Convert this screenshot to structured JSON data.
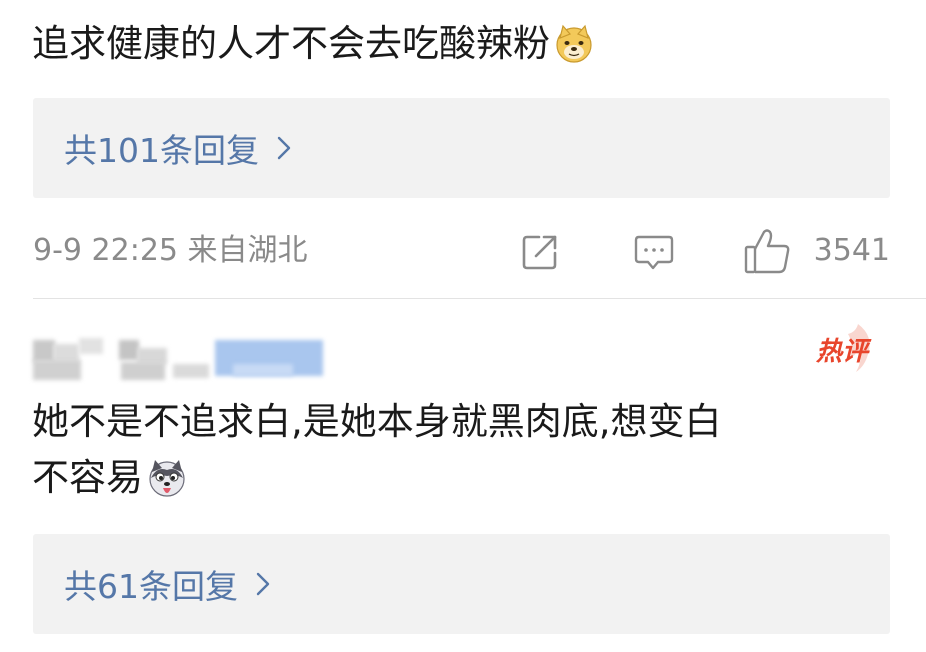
{
  "comment1": {
    "text": "追求健康的人才不会去吃酸辣粉",
    "emoji": "doge-emoji",
    "replies_label": "共101条回复"
  },
  "meta": {
    "time_location": "9-9 22:25 来自湖北",
    "like_count": "3541",
    "icons": [
      "share-icon",
      "comment-icon",
      "like-icon"
    ]
  },
  "comment2": {
    "badge": "热评",
    "line1": "她不是不追求白,是她本身就黑肉底,想变白",
    "line2": "不容易",
    "emoji": "husky-emoji",
    "replies_label": "共61条回复"
  },
  "colors": {
    "link": "#5577a8",
    "meta_gray": "#8a8a8a",
    "reply_bg": "#f2f2f2",
    "hot_red": "#e8452c"
  }
}
